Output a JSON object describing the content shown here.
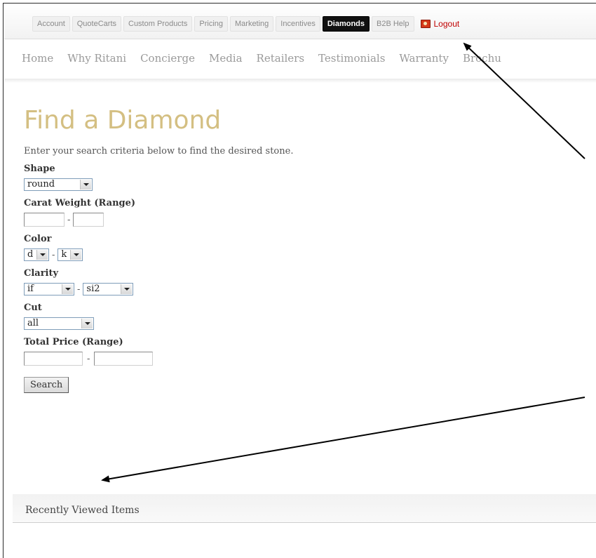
{
  "admin_bar": {
    "tabs": [
      "Account",
      "QuoteCarts",
      "Custom Products",
      "Pricing",
      "Marketing",
      "Incentives",
      "Diamonds",
      "B2B Help"
    ],
    "active_tab": "Diamonds",
    "logout_label": "Logout",
    "logout_icon": "logout-icon"
  },
  "main_nav": {
    "items": [
      "Home",
      "Why Ritani",
      "Concierge",
      "Media",
      "Retailers",
      "Testimonials",
      "Warranty",
      "Brochu"
    ]
  },
  "page": {
    "title": "Find a Diamond",
    "intro": "Enter your search criteria below to find the desired stone."
  },
  "form": {
    "shape": {
      "label": "Shape",
      "value": "round"
    },
    "carat": {
      "label": "Carat Weight (Range)",
      "min": "",
      "max": "",
      "separator": "-"
    },
    "color": {
      "label": "Color",
      "from": "d",
      "to": "k",
      "separator": "-"
    },
    "clarity": {
      "label": "Clarity",
      "from": "if",
      "to": "si2",
      "separator": "-"
    },
    "cut": {
      "label": "Cut",
      "value": "all"
    },
    "price": {
      "label": "Total Price (Range)",
      "min": "",
      "max": "",
      "separator": "-"
    },
    "search_label": "Search"
  },
  "recent": {
    "title": "Recently Viewed Items"
  },
  "colors": {
    "title_gold": "#d4bf82",
    "active_tab_bg": "#111111",
    "logout_red": "#c00000",
    "annotation_arrow": "#000000"
  }
}
